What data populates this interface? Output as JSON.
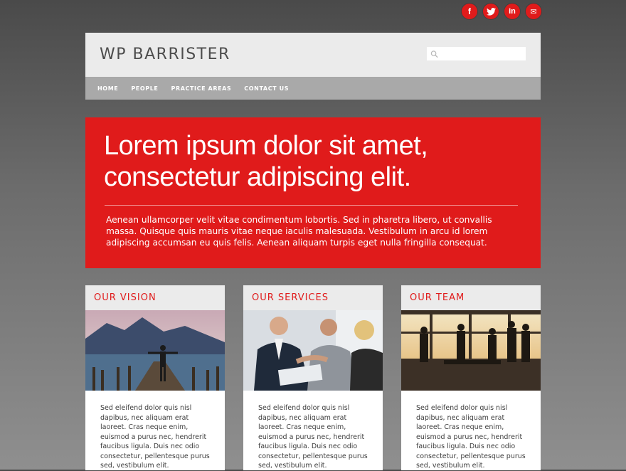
{
  "social": [
    {
      "name": "facebook",
      "glyph": "f"
    },
    {
      "name": "twitter",
      "glyph": "t"
    },
    {
      "name": "linkedin",
      "glyph": "in"
    },
    {
      "name": "email",
      "glyph": "✉"
    }
  ],
  "header": {
    "site_title": "WP BARRISTER",
    "search_placeholder": ""
  },
  "nav": {
    "items": [
      "HOME",
      "PEOPLE",
      "PRACTICE AREAS",
      "CONTACT US"
    ]
  },
  "hero": {
    "headline": "Lorem ipsum dolor sit amet, consectetur adipiscing elit.",
    "body": "Aenean ullamcorper velit vitae condimentum lobortis. Sed in pharetra libero, ut convallis massa. Quisque quis mauris vitae neque iaculis malesuada. Vestibulum in arcu id lorem adipiscing accumsan eu quis felis. Aenean aliquam turpis eget nulla fringilla consequat."
  },
  "cards": [
    {
      "title": "OUR VISION",
      "text": "Sed eleifend dolor quis nisl dapibus, nec aliquam erat laoreet. Cras neque enim, euismod a purus nec, hendrerit faucibus ligula. Duis nec odio consectetur, pellentesque purus sed, vestibulum elit."
    },
    {
      "title": "OUR SERVICES",
      "text": "Sed eleifend dolor quis nisl dapibus, nec aliquam erat laoreet. Cras neque enim, euismod a purus nec, hendrerit faucibus ligula. Duis nec odio consectetur, pellentesque purus sed, vestibulum elit."
    },
    {
      "title": "OUR TEAM",
      "text": "Sed eleifend dolor quis nisl dapibus, nec aliquam erat laoreet. Cras neque enim, euismod a purus nec, hendrerit faucibus ligula. Duis nec odio consectetur, pellentesque purus sed, vestibulum elit."
    }
  ],
  "colors": {
    "accent": "#e01b1b",
    "header_bg": "#ebebeb",
    "nav_bg": "#a9a9a9"
  }
}
